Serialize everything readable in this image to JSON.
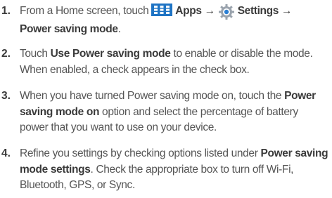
{
  "steps": [
    {
      "number": "1.",
      "parts": {
        "intro": "From a Home screen, touch ",
        "apps_label": "Apps",
        "arrow1": " → ",
        "settings_label": "Settings",
        "arrow2": " →",
        "power_saving_mode": "Power saving mode",
        "end": "."
      },
      "icons": [
        "apps-grid-icon",
        "settings-gear-icon"
      ]
    },
    {
      "number": "2.",
      "parts": {
        "a": "Touch ",
        "b": "Use Power saving mode",
        "c": " to enable or disable the mode. When enabled, a check appears in the check box."
      }
    },
    {
      "number": "3.",
      "parts": {
        "a": "When you have turned Power saving mode on, touch the ",
        "b": "Power saving mode on",
        "c": " option and select the percentage of battery power that you want to use on your device."
      }
    },
    {
      "number": "4.",
      "parts": {
        "a": "Refine you settings by checking options listed under ",
        "b": "Power saving mode settings",
        "c": ". Check the appropriate box to turn off Wi-Fi, Bluetooth, GPS, or Sync."
      }
    }
  ],
  "colors": {
    "text": "#555555",
    "bold": "#3a3a3a",
    "apps_icon_blue": "#1f74c4"
  }
}
